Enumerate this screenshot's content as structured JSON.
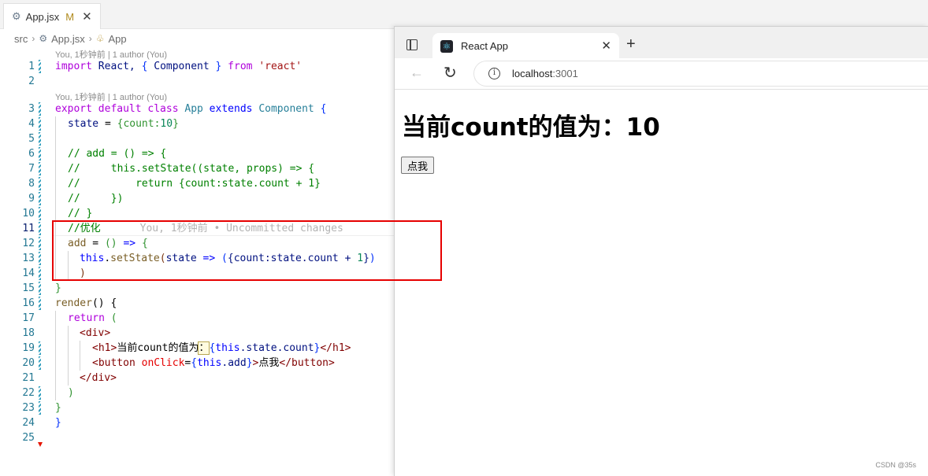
{
  "editor": {
    "tab": {
      "filename": "App.jsx",
      "status": "M",
      "close": "✕"
    },
    "breadcrumb": [
      "src",
      "App.jsx",
      "App"
    ],
    "codelens": [
      "You, 1秒钟前 | 1 author (You)",
      "You, 1秒钟前 | 1 author (You)"
    ],
    "lines": [
      "1",
      "2",
      "3",
      "4",
      "5",
      "6",
      "7",
      "8",
      "9",
      "10",
      "11",
      "12",
      "13",
      "14",
      "15",
      "16",
      "17",
      "18",
      "19",
      "20",
      "21",
      "22",
      "23",
      "24",
      "25"
    ],
    "code": {
      "l1a": "import",
      "l1b": " React, ",
      "l1c": "{",
      "l1d": " Component ",
      "l1e": "}",
      "l1f": " from ",
      "l1g": "'react'",
      "l3a": "export default class ",
      "l3b": "App",
      "l3c": " extends ",
      "l3d": "Component",
      "l3e": " {",
      "l4a": "state",
      "l4b": " = ",
      "l4c": "{count:",
      "l4d": "10",
      "l4e": "}",
      "l6": "// add = () => {",
      "l7": "//     this.setState((state, props) => {",
      "l8": "//         return {count:state.count + 1}",
      "l9": "//     })",
      "l10": "// }",
      "l11": "//优化",
      "l11blame": "You, 1秒钟前 • Uncommitted changes",
      "l12a": "add",
      "l12b": " = ",
      "l12c": "()",
      "l12d": " => ",
      "l12e": "{",
      "l13a": "this",
      "l13b": ".",
      "l13c": "setState",
      "l13d": "(",
      "l13e": "state",
      "l13f": " => ",
      "l13g": "(",
      "l13h": "{count:state.count + ",
      "l13i": "1",
      "l13j": "}",
      "l13k": ")",
      "l14": ")",
      "l15": "}",
      "l16a": "render",
      "l16b": "() {",
      "l17a": "return",
      "l17b": " (",
      "l18a": "<",
      "l18b": "div",
      "l18c": ">",
      "l19a": "<",
      "l19b": "h1",
      "l19c": ">",
      "l19d": "当前count的值为",
      "l19e": "：",
      "l19f": "{",
      "l19g": "this",
      "l19h": ".state.count",
      "l19i": "}",
      "l19j": "</",
      "l19k": "h1",
      "l19l": ">",
      "l20a": "<",
      "l20b": "button",
      "l20c": " onClick",
      "l20d": "=",
      "l20e": "{",
      "l20f": "this",
      "l20g": ".add",
      "l20h": "}",
      "l20i": ">",
      "l20j": "点我",
      "l20k": "</",
      "l20l": "button",
      "l20m": ">",
      "l21a": "</",
      "l21b": "div",
      "l21c": ">",
      "l22": ")",
      "l23": "}",
      "l24": "}"
    }
  },
  "browser": {
    "tab_title": "React App",
    "tab_close": "✕",
    "new_tab": "+",
    "url_host": "localhost",
    "url_port": ":3001",
    "page": {
      "heading": "当前count的值为：10",
      "button": "点我"
    }
  },
  "watermark": "CSDN @35s"
}
